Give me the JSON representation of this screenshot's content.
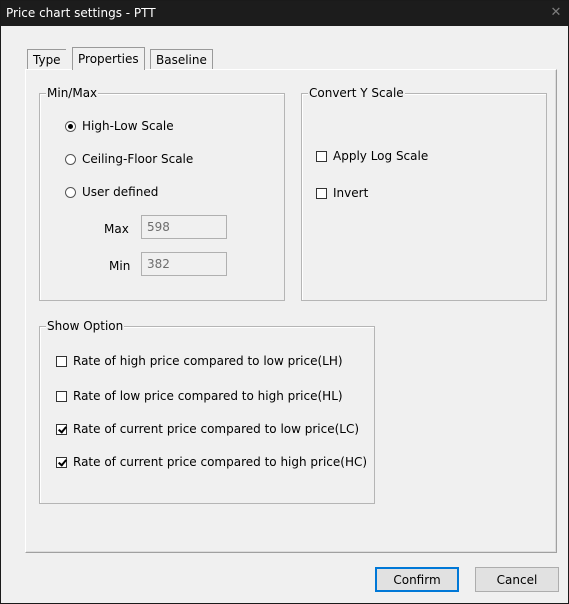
{
  "window": {
    "title": "Price chart settings - PTT",
    "close_glyph": "✕"
  },
  "tabs": [
    {
      "label": "Type",
      "active": false
    },
    {
      "label": "Properties",
      "active": true
    },
    {
      "label": "Baseline",
      "active": false
    }
  ],
  "minmax": {
    "legend": "Min/Max",
    "options": [
      {
        "label": "High-Low Scale",
        "selected": true
      },
      {
        "label": "Ceiling-Floor Scale",
        "selected": false
      },
      {
        "label": "User defined",
        "selected": false
      }
    ],
    "max_label": "Max",
    "max_value": "598",
    "min_label": "Min",
    "min_value": "382"
  },
  "convert_y": {
    "legend": "Convert Y Scale",
    "options": [
      {
        "label": "Apply Log Scale",
        "checked": false
      },
      {
        "label": "Invert",
        "checked": false
      }
    ]
  },
  "show_option": {
    "legend": "Show Option",
    "options": [
      {
        "label": "Rate of high price compared to low price(LH)",
        "checked": false
      },
      {
        "label": "Rate of low price compared to high price(HL)",
        "checked": false
      },
      {
        "label": "Rate of current price compared to low price(LC)",
        "checked": true
      },
      {
        "label": "Rate of current price compared to high price(HC)",
        "checked": true
      }
    ]
  },
  "buttons": {
    "confirm": "Confirm",
    "cancel": "Cancel"
  },
  "colors": {
    "titlebar_bg": "#1c1c1c",
    "dialog_bg": "#f0f0f0",
    "default_button_border": "#0078d7"
  }
}
